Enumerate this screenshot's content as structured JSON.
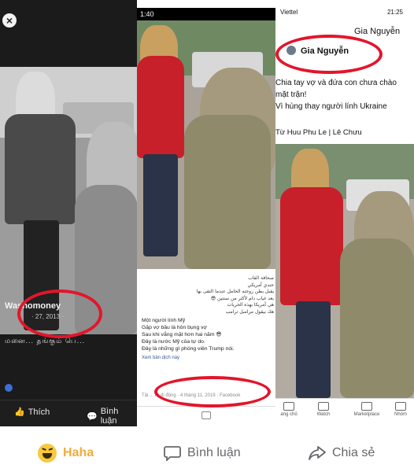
{
  "panel_left": {
    "close_symbol": "×",
    "name": "Washomoney",
    "date": "· 27, 2013 ·",
    "caption": "மனை... தங்கும் பெ...",
    "like_label": "Thích",
    "comment_label": "Bình luận"
  },
  "panel_middle": {
    "status_time": "1:40",
    "arabic_lines": [
      "صحافة القاب",
      "جندي أمريكي",
      "يقبل بطن زوجته الحامل عندما التقى بها",
      "بعد غياب دام لأكثر من سنتين 😎",
      "هي أمريكا بهذه الحريات",
      "هك بيقول مرامبل ترامب"
    ],
    "viet_lines": [
      "Một người lính Mỹ",
      "Gặp vợ bầu là hôn bụng vợ",
      "Sau khi vắng mặt hơn hai năm 😎",
      "Đây là nước Mỹ của tự do.",
      "Đây là những gì phóng viên Trump nói."
    ],
    "see_translation": "Xem bản dịch này",
    "meta": "Tải ... từ di động · 4 tháng 11, 2019 · Facebook"
  },
  "panel_right": {
    "carrier": "Viettel",
    "time": "21:25",
    "name_top": "Gia Nguyễn",
    "name": "Gia Nguyễn",
    "post_lines": [
      "Chia tay vợ và đứa con chưa chào",
      "mặt trận!",
      "Vì hùng thay người lính Ukraine"
    ],
    "source": "Từ Huu Phu Le | Lê Chưu",
    "tabs": [
      "ang chủ",
      "Watch",
      "Marketplace",
      "Nhóm"
    ]
  },
  "reactions": {
    "haha_label": "Haha",
    "comment_label": "Bình luận",
    "share_label": "Chia sẻ"
  },
  "colors": {
    "highlight_ring": "#e3152b",
    "haha": "#f0ad3c",
    "action_gray": "#65676b",
    "fb_link": "#385898"
  }
}
